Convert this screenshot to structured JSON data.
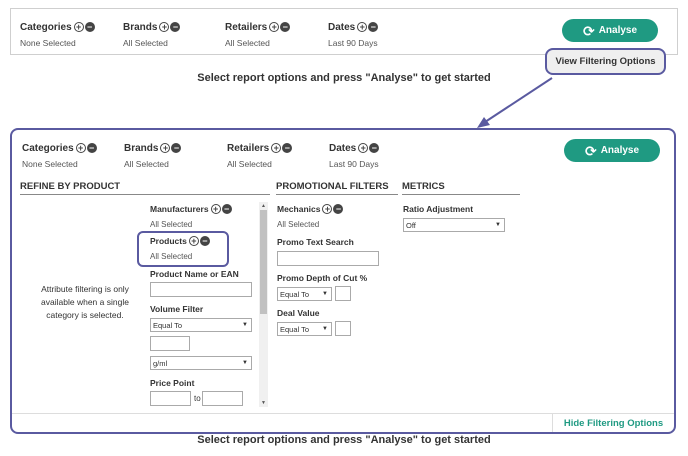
{
  "top_bar": {
    "filters": [
      {
        "label": "Categories",
        "value": "None Selected"
      },
      {
        "label": "Brands",
        "value": "All Selected"
      },
      {
        "label": "Retailers",
        "value": "All Selected"
      },
      {
        "label": "Dates",
        "value": "Last 90 Days"
      }
    ],
    "analyse_label": "Analyse"
  },
  "view_filtering_label": "View Filtering Options",
  "caption_top": "Select report options and press \"Analyse\" to get started",
  "caption_bottom": "Select report options and press \"Analyse\" to get started",
  "panel": {
    "filters": [
      {
        "label": "Categories",
        "value": "None Selected"
      },
      {
        "label": "Brands",
        "value": "All Selected"
      },
      {
        "label": "Retailers",
        "value": "All Selected"
      },
      {
        "label": "Dates",
        "value": "Last 90 Days"
      }
    ],
    "analyse_label": "Analyse",
    "refine": {
      "heading": "REFINE BY PRODUCT",
      "attribute_note": "Attribute filtering is only available when a single category is selected.",
      "manufacturers_label": "Manufacturers",
      "manufacturers_value": "All Selected",
      "products_label": "Products",
      "products_value": "All Selected",
      "product_name_label": "Product Name or EAN",
      "volume_filter_label": "Volume Filter",
      "volume_operator": "Equal To",
      "volume_unit": "g/ml",
      "price_point_label": "Price Point",
      "price_to": "to"
    },
    "promo": {
      "heading": "PROMOTIONAL FILTERS",
      "mechanics_label": "Mechanics",
      "mechanics_value": "All Selected",
      "promo_text_label": "Promo Text Search",
      "depth_label": "Promo Depth of Cut %",
      "depth_operator": "Equal To",
      "deal_value_label": "Deal Value",
      "deal_operator": "Equal To"
    },
    "metrics": {
      "heading": "METRICS",
      "ratio_label": "Ratio Adjustment",
      "ratio_value": "Off"
    },
    "hide_filtering_label": "Hide Filtering Options"
  }
}
